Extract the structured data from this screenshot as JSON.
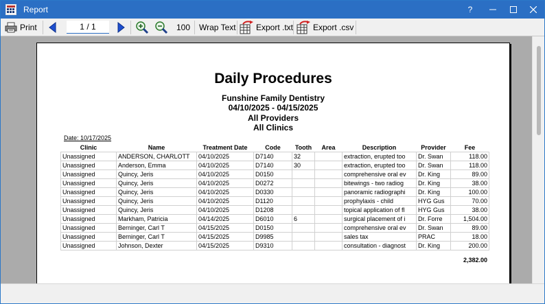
{
  "window": {
    "title": "Report",
    "help_glyph": "?",
    "minimize_glyph": "—",
    "close_glyph": "✕"
  },
  "toolbar": {
    "print_label": "Print",
    "page_current": "1",
    "page_separator": "/",
    "page_total": "1",
    "zoom_value": "100",
    "wrap_text_label": "Wrap Text",
    "export_txt_label": "Export .txt",
    "export_csv_label": "Export .csv"
  },
  "report": {
    "title": "Daily Procedures",
    "practice": "Funshine Family Dentistry",
    "date_range": "04/10/2025 - 04/15/2025",
    "providers": "All Providers",
    "clinics": "All Clinics",
    "run_date": "Date: 10/17/2025",
    "columns": [
      "Clinic",
      "Name",
      "Treatment Date",
      "Code",
      "Tooth",
      "Area",
      "Description",
      "Provider",
      "Fee"
    ],
    "rows": [
      [
        "Unassigned",
        "ANDERSON, CHARLOTT",
        "04/10/2025",
        "D7140",
        "32",
        "",
        "extraction,  erupted too",
        "Dr. Swan",
        "118.00"
      ],
      [
        "Unassigned",
        "Anderson, Emma",
        "04/10/2025",
        "D7140",
        "30",
        "",
        "extraction,  erupted too",
        "Dr. Swan",
        "118.00"
      ],
      [
        "Unassigned",
        "Quincy, Jeris",
        "04/10/2025",
        "D0150",
        "",
        "",
        "comprehensive  oral ev",
        "Dr. King",
        "89.00"
      ],
      [
        "Unassigned",
        "Quincy, Jeris",
        "04/10/2025",
        "D0272",
        "",
        "",
        "bitewings  - two radiog",
        "Dr. King",
        "38.00"
      ],
      [
        "Unassigned",
        "Quincy, Jeris",
        "04/10/2025",
        "D0330",
        "",
        "",
        "panoramic radiographi",
        "Dr. King",
        "100.00"
      ],
      [
        "Unassigned",
        "Quincy, Jeris",
        "04/10/2025",
        "D1120",
        "",
        "",
        "prophylaxis - child",
        "HYG Gus",
        "70.00"
      ],
      [
        "Unassigned",
        "Quincy, Jeris",
        "04/10/2025",
        "D1208",
        "",
        "",
        "topical  application  of fl",
        "HYG Gus",
        "38.00"
      ],
      [
        "Unassigned",
        "Markham, Patricia",
        "04/14/2025",
        "D6010",
        "6",
        "",
        "surgical  placement  of i",
        "Dr. Forre",
        "1,504.00"
      ],
      [
        "Unassigned",
        "Berninger, Carl T",
        "04/15/2025",
        "D0150",
        "",
        "",
        "comprehensive  oral ev",
        "Dr. Swan",
        "89.00"
      ],
      [
        "Unassigned",
        "Berninger, Carl T",
        "04/15/2025",
        "D9985",
        "",
        "",
        "sales tax",
        "PRAC",
        "18.00"
      ],
      [
        "Unassigned",
        "Johnson, Dexter",
        "04/15/2025",
        "D9310",
        "",
        "",
        "consultation  - diagnost",
        "Dr. King",
        "200.00"
      ]
    ],
    "total": "2,382.00"
  },
  "colors": {
    "titlebar": "#2b6fc4",
    "viewport": "#ababab",
    "accent": "#1e4fcf"
  }
}
